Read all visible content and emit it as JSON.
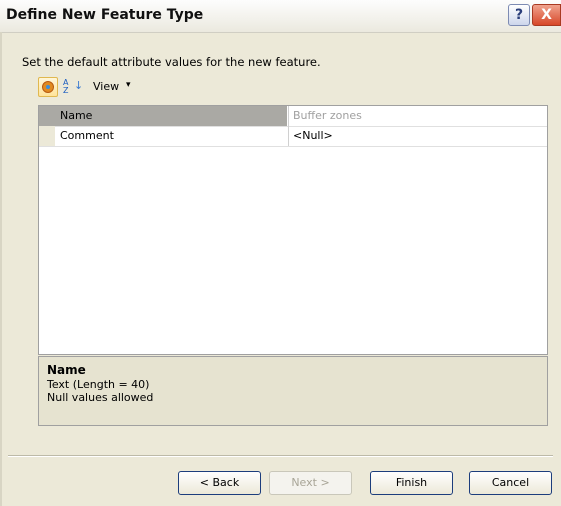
{
  "window": {
    "title": "Define New Feature Type"
  },
  "titlebar": {
    "help_glyph": "?",
    "close_glyph": "X"
  },
  "instruction": "Set the default attribute values for the new feature.",
  "toolbar": {
    "view_label": "View",
    "view_caret": "▾",
    "az_top": "A",
    "az_bottom": "Z",
    "az_arrow": "↓"
  },
  "grid": {
    "rows": [
      {
        "name": "Name",
        "value": "Buffer zones",
        "selected": true
      },
      {
        "name": "Comment",
        "value": "<Null>",
        "selected": false
      }
    ]
  },
  "description": {
    "title": "Name",
    "line1": "Text (Length = 40)",
    "line2": "Null values allowed"
  },
  "buttons": {
    "back": "< Back",
    "next": "Next >",
    "finish": "Finish",
    "cancel": "Cancel"
  }
}
